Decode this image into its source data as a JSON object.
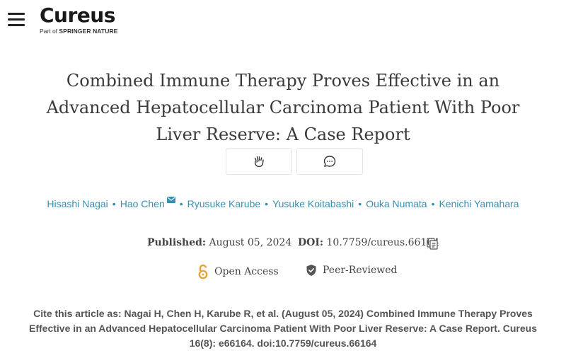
{
  "header": {
    "logo_text": "Cureus",
    "logo_sub_prefix": "Part of ",
    "logo_sub_brand": "SPRINGER NATURE"
  },
  "article": {
    "title": "Combined Immune Therapy Proves Effective in an Advanced Hepatocellular Carcinoma Patient With Poor Liver Reserve: A Case Report",
    "authors": [
      "Hisashi Nagai",
      "Hao Chen",
      "Ryusuke Karube",
      "Yusuke Koitabashi",
      "Ouka Numata",
      "Kenichi Yamahara"
    ],
    "published_label": "Published:",
    "published_date": "August 05, 2024",
    "doi_label": "DOI:",
    "doi_value": "10.7759/cureus.66164",
    "open_access": "Open Access",
    "peer_reviewed": "Peer-Reviewed",
    "citation": "Cite this article as: Nagai H, Chen H, Karube R, et al. (August 05, 2024) Combined Immune Therapy Proves Effective in an Advanced Hepatocellular Carcinoma Patient With Poor Liver Reserve: A Case Report. Cureus 16(8): e66164. doi:10.7759/cureus.66164"
  },
  "icons": {
    "menu": "hamburger-menu-icon",
    "applaud": "clap-hands-icon",
    "comment": "comment-bubble-icon",
    "email": "envelope-icon",
    "copy": "copy-icon",
    "open_access": "open-lock-icon",
    "peer_reviewed": "shield-check-icon"
  },
  "colors": {
    "author_link": "#3a8fb0",
    "open_access": "#e8a23a",
    "peer_shield": "#555555"
  }
}
